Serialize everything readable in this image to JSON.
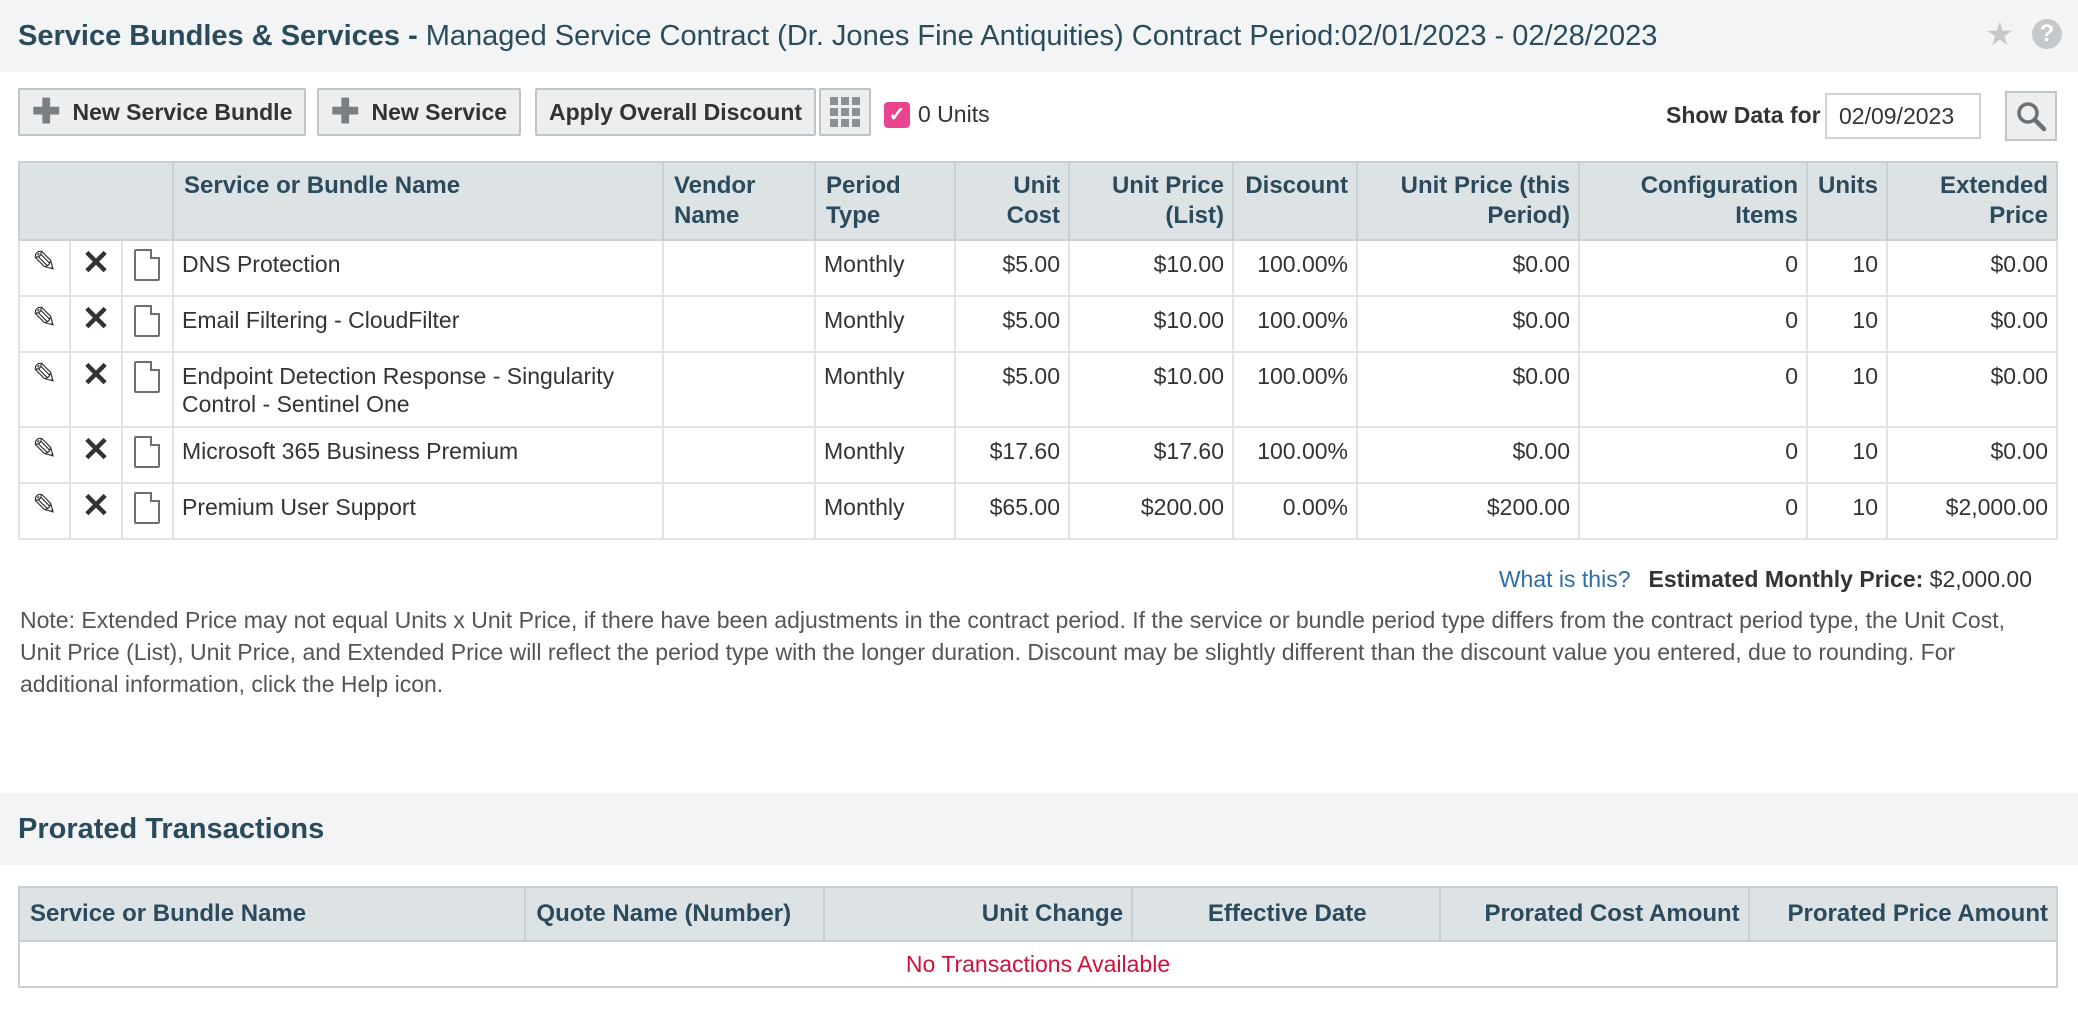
{
  "header": {
    "title_strong": "Service Bundles & Services -",
    "title_rest": "Managed Service Contract (Dr. Jones Fine Antiquities) Contract Period:02/01/2023 - 02/28/2023",
    "star_icon": "star-icon",
    "help_icon": "help-icon",
    "help_glyph": "?"
  },
  "toolbar": {
    "new_bundle": "New Service Bundle",
    "new_service": "New Service",
    "apply_discount": "Apply Overall Discount",
    "units_checkbox_label": "0 Units",
    "units_checked": true,
    "show_data_label": "Show Data for",
    "show_data_date": "02/09/2023"
  },
  "services_table": {
    "columns": [
      "Service or Bundle Name",
      "Vendor Name",
      "Period Type",
      "Unit Cost",
      "Unit Price (List)",
      "Discount",
      "Unit Price (this Period)",
      "Configuration Items",
      "Units",
      "Extended Price"
    ],
    "rows": [
      {
        "name": "DNS Protection",
        "vendor": "",
        "period": "Monthly",
        "unit_cost": "$5.00",
        "unit_price_list": "$10.00",
        "discount": "100.00%",
        "unit_price_period": "$0.00",
        "config_items": "0",
        "units": "10",
        "extended": "$0.00"
      },
      {
        "name": "Email Filtering - CloudFilter",
        "vendor": "",
        "period": "Monthly",
        "unit_cost": "$5.00",
        "unit_price_list": "$10.00",
        "discount": "100.00%",
        "unit_price_period": "$0.00",
        "config_items": "0",
        "units": "10",
        "extended": "$0.00"
      },
      {
        "name": "Endpoint Detection Response - Singularity Control - Sentinel One",
        "vendor": "",
        "period": "Monthly",
        "unit_cost": "$5.00",
        "unit_price_list": "$10.00",
        "discount": "100.00%",
        "unit_price_period": "$0.00",
        "config_items": "0",
        "units": "10",
        "extended": "$0.00"
      },
      {
        "name": "Microsoft 365 Business Premium",
        "vendor": "",
        "period": "Monthly",
        "unit_cost": "$17.60",
        "unit_price_list": "$17.60",
        "discount": "100.00%",
        "unit_price_period": "$0.00",
        "config_items": "0",
        "units": "10",
        "extended": "$0.00"
      },
      {
        "name": "Premium User Support",
        "vendor": "",
        "period": "Monthly",
        "unit_cost": "$65.00",
        "unit_price_list": "$200.00",
        "discount": "0.00%",
        "unit_price_period": "$200.00",
        "config_items": "0",
        "units": "10",
        "extended": "$2,000.00"
      }
    ]
  },
  "summary": {
    "what_is_this": "What is this?",
    "estimated_label": "Estimated Monthly Price:",
    "estimated_value": "$2,000.00"
  },
  "note": "Note: Extended Price may not equal Units x Unit Price, if there have been adjustments in the contract period. If the service or bundle period type differs from the contract period type, the Unit Cost, Unit Price (List), Unit Price, and Extended Price will reflect the period type with the longer duration. Discount may be slightly different than the discount value you entered, due to rounding. For additional information, click the Help icon.",
  "prorated": {
    "title": "Prorated Transactions",
    "columns": [
      "Service or Bundle Name",
      "Quote Name (Number)",
      "Unit Change",
      "Effective Date",
      "Prorated Cost Amount",
      "Prorated Price Amount"
    ],
    "empty_message": "No Transactions Available"
  },
  "colors": {
    "header_text": "#2b4b5c",
    "link": "#2e6ea6",
    "checkbox": "#e8448f",
    "empty_message": "#d0103a"
  }
}
